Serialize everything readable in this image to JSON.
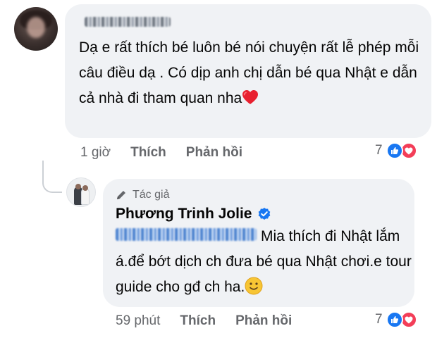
{
  "comment": {
    "author_name_text": "",
    "text": "Dạ e rất thích bé luôn bé nói chuyện rất lễ phép mỗi câu điều dạ . Có dịp anh chị dẫn bé qua Nhật e dẫn cả nhà đi tham quan nha",
    "time": "1 giờ",
    "like_label": "Thích",
    "reply_label": "Phản hồi",
    "reaction_count": "7",
    "emoji": "heart-emoji"
  },
  "reply": {
    "badge_label": "Tác giả",
    "author_name": "Phương Trinh Jolie",
    "verified_icon": "verified-badge-icon",
    "text": "Mia thích đi Nhật lắm á.để bớt dịch ch đưa bé qua Nhật chơi.e tour guide cho gđ ch ha.",
    "time": "59 phút",
    "like_label": "Thích",
    "reply_label": "Phản hồi",
    "reaction_count": "7",
    "emoji": "smile-emoji"
  },
  "colors": {
    "bubble": "#f0f2f5",
    "secondary_text": "#65676b",
    "like_blue": "#1877f2",
    "love_red": "#f33e58"
  }
}
